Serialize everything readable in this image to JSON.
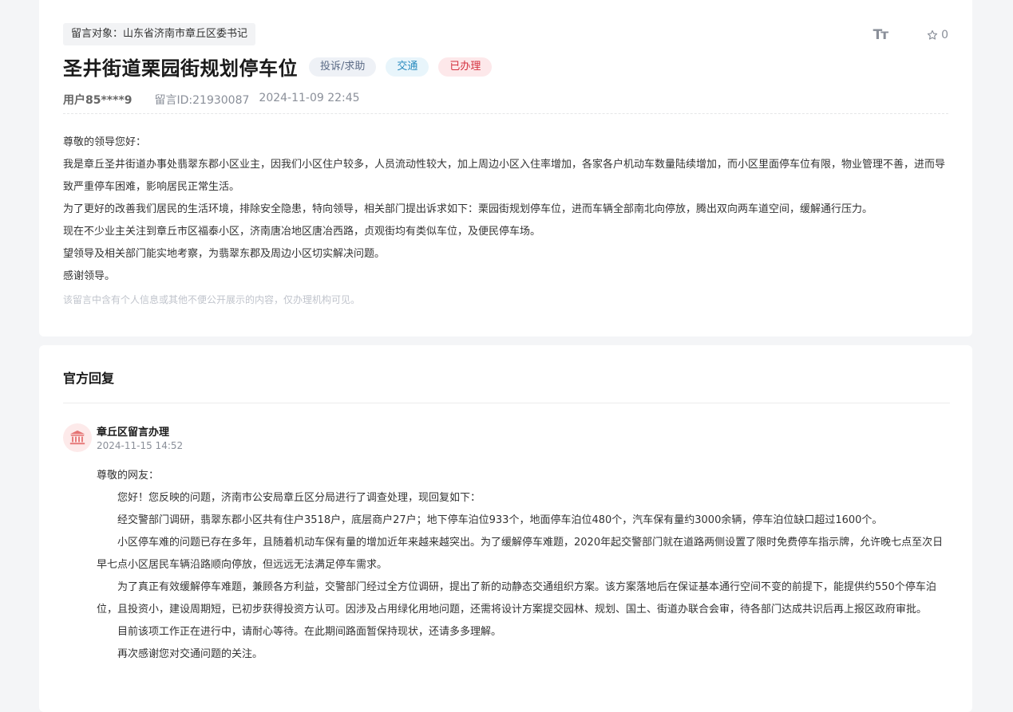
{
  "message": {
    "target_label": "留言对象：山东省济南市章丘区委书记",
    "font_tool_label": "Tт",
    "fav_count": "0",
    "title": "圣井街道栗园街规划停车位",
    "badges": {
      "type": "投诉/求助",
      "category": "交通",
      "status": "已办理"
    },
    "user": "用户85****9",
    "message_id": "留言ID:21930087",
    "datetime": "2024-11-09 22:45",
    "paragraphs": [
      "尊敬的领导您好：",
      "我是章丘圣井街道办事处翡翠东郡小区业主，因我们小区住户较多，人员流动性较大，加上周边小区入住率增加，各家各户机动车数量陆续增加，而小区里面停车位有限，物业管理不善，进而导致严重停车困难，影响居民正常生活。",
      "为了更好的改善我们居民的生活环境，排除安全隐患，特向领导，相关部门提出诉求如下：栗园街规划停车位，进而车辆全部南北向停放，腾出双向两车道空间，缓解通行压力。",
      "现在不少业主关注到章丘市区福泰小区，济南唐冶地区唐冶西路，贞观街均有类似车位，及便民停车场。",
      "望领导及相关部门能实地考察，为翡翠东郡及周边小区切实解决问题。",
      "感谢领导。"
    ],
    "privacy_note": "该留言中含有个人信息或其他不便公开展示的内容，仅办理机构可见。"
  },
  "reply": {
    "section_title": "官方回复",
    "org": "章丘区留言办理",
    "datetime": "2024-11-15 14:52",
    "greeting": "尊敬的网友：",
    "paragraphs": [
      "您好！您反映的问题，济南市公安局章丘区分局进行了调查处理，现回复如下：",
      "经交警部门调研，翡翠东郡小区共有住户3518户，底层商户27户；地下停车泊位933个，地面停车泊位480个，汽车保有量约3000余辆，停车泊位缺口超过1600个。",
      "小区停车难的问题已存在多年，且随着机动车保有量的增加近年来越来越突出。为了缓解停车难题，2020年起交警部门就在道路两侧设置了限时免费停车指示牌，允许晚七点至次日早七点小区居民车辆沿路顺向停放，但远远无法满足停车需求。",
      "为了真正有效缓解停车难题，兼顾各方利益，交警部门经过全方位调研，提出了新的动静态交通组织方案。该方案落地后在保证基本通行空间不变的前提下，能提供约550个停车泊位，且投资小，建设周期短，已初步获得投资方认可。因涉及占用绿化用地问题，还需将设计方案提交园林、规划、国土、街道办联合会审，待各部门达成共识后再上报区政府审批。",
      "目前该项工作正在进行中，请耐心等待。在此期间路面暂保持现状，还请多多理解。",
      "再次感谢您对交通问题的关注。"
    ]
  },
  "colors": {
    "status_red": "#d4313f",
    "category_blue": "#2a8bbf",
    "avatar_red": "#e57373"
  }
}
